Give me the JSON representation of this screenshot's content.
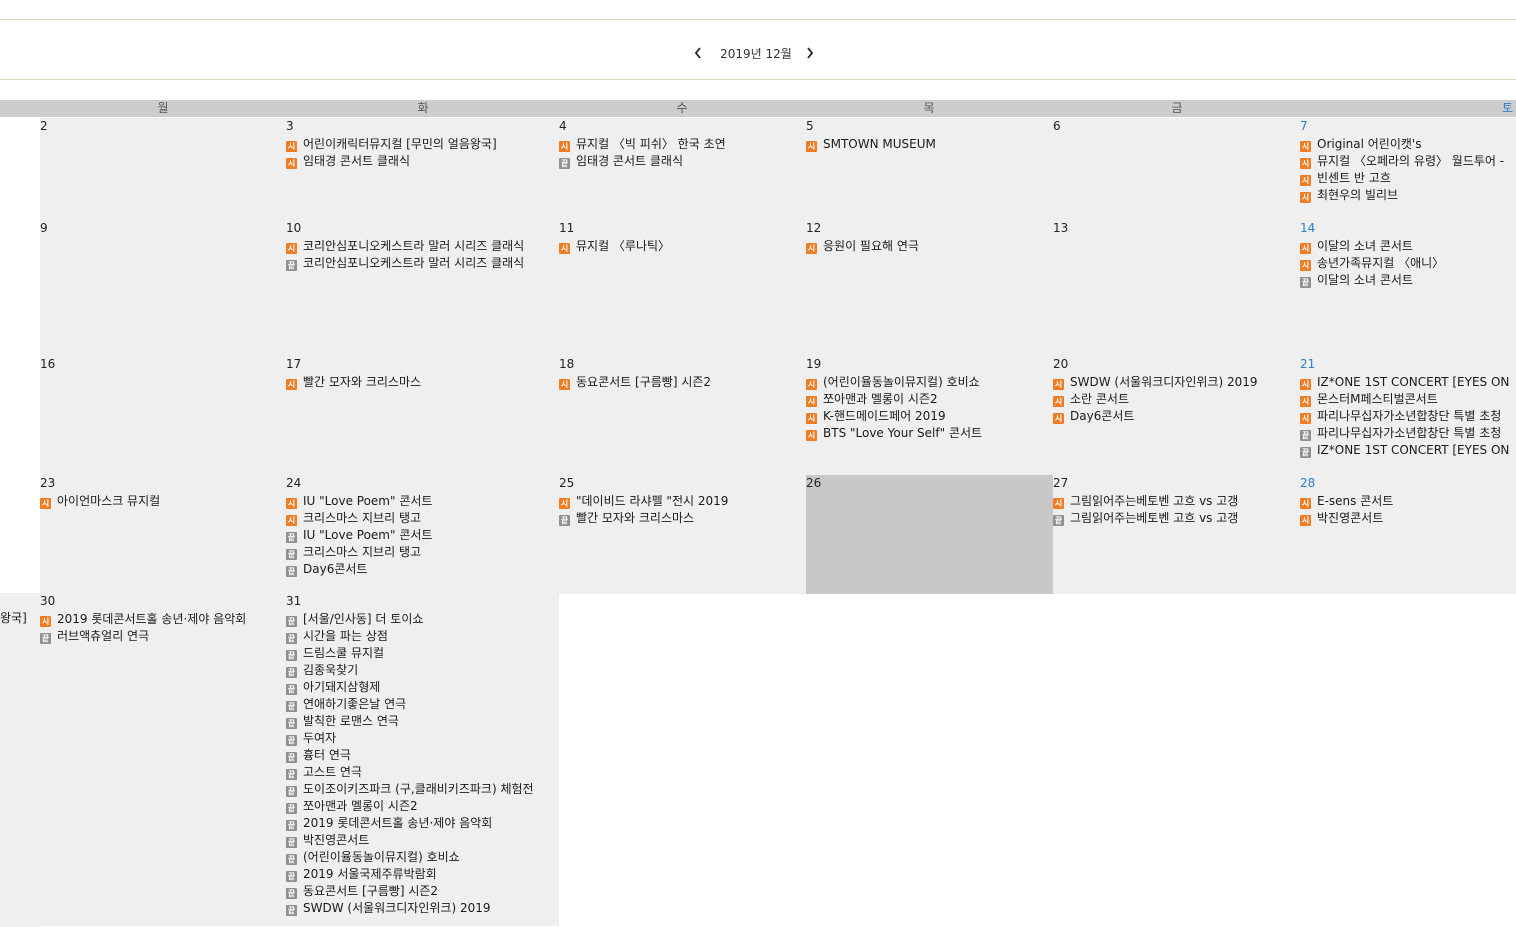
{
  "calendar": {
    "month_label": "2019년 12월",
    "weekdays": [
      "월",
      "화",
      "수",
      "목",
      "금",
      "토"
    ],
    "badge_start": "시",
    "badge_end": "끝",
    "weeks": [
      [
        {
          "day": "2",
          "events": []
        },
        {
          "day": "3",
          "events": [
            {
              "type": "start",
              "title": "어린이캐릭터뮤지컬 [무민의 얼음왕국]"
            },
            {
              "type": "start",
              "title": "임태경 콘서트 클래식"
            }
          ]
        },
        {
          "day": "4",
          "events": [
            {
              "type": "start",
              "title": "뮤지컬 〈빅 피쉬〉 한국 초연"
            },
            {
              "type": "end",
              "title": "임태경 콘서트 클래식"
            }
          ]
        },
        {
          "day": "5",
          "events": [
            {
              "type": "start",
              "title": "SMTOWN MUSEUM"
            }
          ]
        },
        {
          "day": "6",
          "events": []
        },
        {
          "day": "7",
          "events": [
            {
              "type": "start",
              "title": "Original 어린이캣's"
            },
            {
              "type": "start",
              "title": "뮤지컬 〈오페라의 유령〉 월드투어 -"
            },
            {
              "type": "start",
              "title": "빈센트 반 고흐"
            },
            {
              "type": "start",
              "title": "최현우의 빌리브"
            }
          ]
        }
      ],
      [
        {
          "day": "9",
          "events": []
        },
        {
          "day": "10",
          "events": [
            {
              "type": "start",
              "title": "코리안심포니오케스트라 말러 시리즈 클래식"
            },
            {
              "type": "end",
              "title": "코리안심포니오케스트라 말러 시리즈 클래식"
            }
          ]
        },
        {
          "day": "11",
          "events": [
            {
              "type": "start",
              "title": "뮤지컬 〈루나틱〉"
            }
          ]
        },
        {
          "day": "12",
          "events": [
            {
              "type": "start",
              "title": "응원이 필요해 연극"
            }
          ]
        },
        {
          "day": "13",
          "events": []
        },
        {
          "day": "14",
          "events": [
            {
              "type": "start",
              "title": "이달의 소녀 콘서트"
            },
            {
              "type": "start",
              "title": "송년가족뮤지컬 〈애니〉"
            },
            {
              "type": "end",
              "title": "이달의 소녀 콘서트"
            }
          ]
        }
      ],
      [
        {
          "day": "16",
          "events": []
        },
        {
          "day": "17",
          "events": [
            {
              "type": "start",
              "title": "빨간 모자와 크리스마스"
            }
          ]
        },
        {
          "day": "18",
          "events": [
            {
              "type": "start",
              "title": "동요콘서트 [구름빵] 시즌2"
            }
          ]
        },
        {
          "day": "19",
          "events": [
            {
              "type": "start",
              "title": "(어린이율동놀이뮤지컬) 호비쇼"
            },
            {
              "type": "start",
              "title": "쪼아맨과 멜롱이 시즌2"
            },
            {
              "type": "start",
              "title": "K-핸드메이드페어 2019"
            },
            {
              "type": "start",
              "title": "BTS \"Love Your Self\" 콘서트"
            }
          ]
        },
        {
          "day": "20",
          "events": [
            {
              "type": "start",
              "title": "SWDW (서울워크디자인위크) 2019"
            },
            {
              "type": "start",
              "title": "소란 콘서트"
            },
            {
              "type": "start",
              "title": "Day6콘서트"
            }
          ]
        },
        {
          "day": "21",
          "events": [
            {
              "type": "start",
              "title": "IZ*ONE 1ST CONCERT [EYES ON"
            },
            {
              "type": "start",
              "title": "몬스터M페스티벌콘서트"
            },
            {
              "type": "start",
              "title": "파리나무십자가소년합창단 특별 초청"
            },
            {
              "type": "end",
              "title": "파리나무십자가소년합창단 특별 초청"
            },
            {
              "type": "end",
              "title": "IZ*ONE 1ST CONCERT [EYES ON"
            }
          ]
        }
      ],
      [
        {
          "day": "23",
          "events": [
            {
              "type": "start",
              "title": "아이언마스크 뮤지컬"
            }
          ]
        },
        {
          "day": "24",
          "events": [
            {
              "type": "start",
              "title": "IU \"Love Poem\" 콘서트"
            },
            {
              "type": "start",
              "title": "크리스마스 지브리 탱고"
            },
            {
              "type": "end",
              "title": "IU \"Love Poem\" 콘서트"
            },
            {
              "type": "end",
              "title": "크리스마스 지브리 탱고"
            },
            {
              "type": "end",
              "title": "Day6콘서트"
            }
          ]
        },
        {
          "day": "25",
          "events": [
            {
              "type": "start",
              "title": "\"데이비드 라샤펠 \"전시 2019"
            },
            {
              "type": "end",
              "title": "빨간 모자와 크리스마스"
            }
          ]
        },
        {
          "day": "26",
          "events": [],
          "today": true
        },
        {
          "day": "27",
          "events": [
            {
              "type": "start",
              "title": "그림읽어주는베토벤 고흐 vs 고갱"
            },
            {
              "type": "end",
              "title": "그림읽어주는베토벤 고흐 vs 고갱"
            }
          ]
        },
        {
          "day": "28",
          "events": [
            {
              "type": "start",
              "title": "E-sens 콘서트"
            },
            {
              "type": "start",
              "title": "박진영콘서트"
            }
          ]
        }
      ],
      [
        {
          "day": "30",
          "events": [
            {
              "type": "start",
              "title": "2019 롯데콘서트홀 송년·제야 음악회"
            },
            {
              "type": "end",
              "title": "러브액츄얼리 연극"
            }
          ]
        },
        {
          "day": "31",
          "events": [
            {
              "type": "end",
              "title": "[서울/인사동] 더 토이쇼"
            },
            {
              "type": "end",
              "title": "시간을 파는 상점"
            },
            {
              "type": "end",
              "title": "드림스쿨 뮤지컬"
            },
            {
              "type": "end",
              "title": "김종욱찾기"
            },
            {
              "type": "end",
              "title": "아기돼지삼형제"
            },
            {
              "type": "end",
              "title": "연애하기좋은날 연극"
            },
            {
              "type": "end",
              "title": "발칙한 로맨스 연극"
            },
            {
              "type": "end",
              "title": "두여자"
            },
            {
              "type": "end",
              "title": "흉터 연극"
            },
            {
              "type": "end",
              "title": "고스트 연극"
            },
            {
              "type": "end",
              "title": "도이조이키즈파크 (구,클래비키즈파크) 체험전"
            },
            {
              "type": "end",
              "title": "쪼아맨과 멜롱이 시즌2"
            },
            {
              "type": "end",
              "title": "2019 롯데콘서트홀 송년·제야 음악회"
            },
            {
              "type": "end",
              "title": "박진영콘서트"
            },
            {
              "type": "end",
              "title": "(어린이율동놀이뮤지컬) 호비쇼"
            },
            {
              "type": "end",
              "title": "2019 서울국제주류박람회"
            },
            {
              "type": "end",
              "title": "동요콘서트 [구름빵] 시즌2"
            },
            {
              "type": "end",
              "title": "SWDW (서울워크디자인위크) 2019"
            }
          ]
        }
      ]
    ],
    "sunday_29_overflow": "왕국]"
  }
}
